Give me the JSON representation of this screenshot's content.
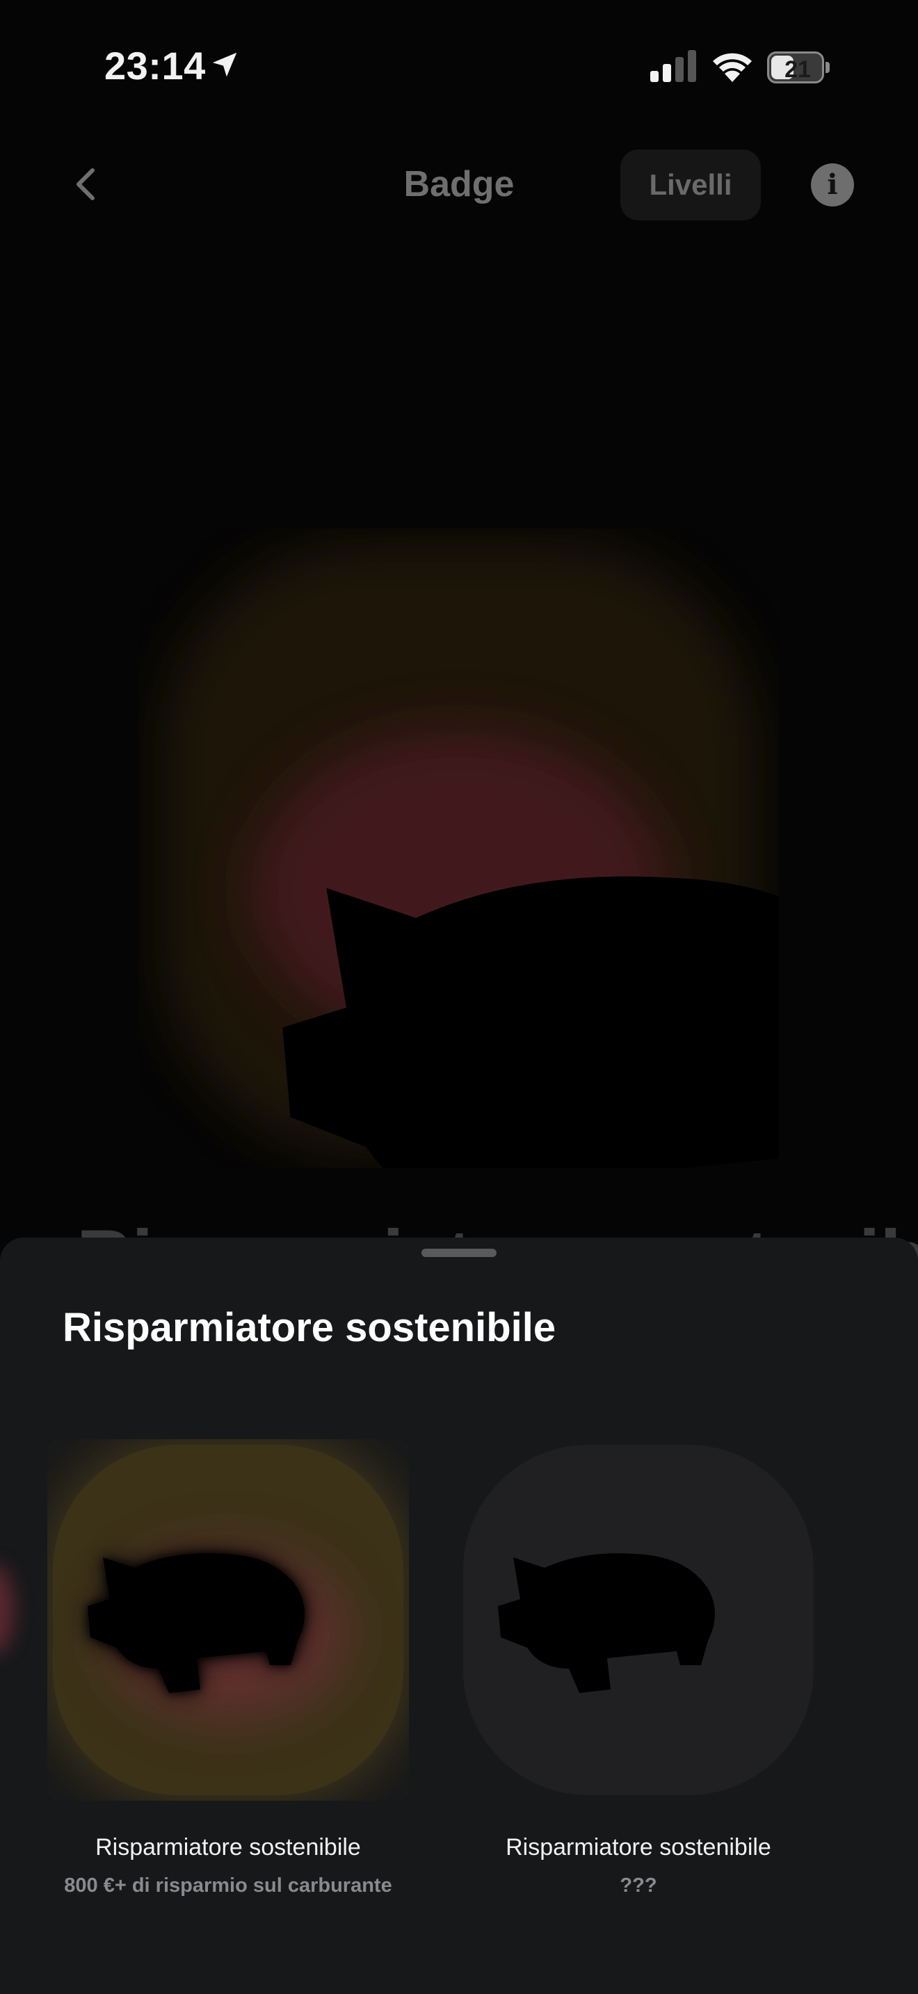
{
  "status_bar": {
    "time": "23:14",
    "battery_level": "21",
    "battery_fraction": 0.21,
    "icons": [
      "location-arrow-icon",
      "cellular-signal-icon",
      "wifi-icon",
      "battery-icon"
    ]
  },
  "nav": {
    "title": "Badge",
    "levels_label": "Livelli",
    "info_label": "i",
    "back_icon": "chevron-left-icon"
  },
  "hero": {
    "badge_icon": "piggy-bank-icon",
    "title_peek": "Risparmiatore sostenibile"
  },
  "sheet": {
    "title": "Risparmiatore sostenibile",
    "badges": [
      {
        "name": "Risparmiatore sostenibile",
        "description": "800 €+ di risparmio sul carburante",
        "state": "unlocked",
        "icon": "piggy-bank-icon"
      },
      {
        "name": "Risparmiatore sostenibile",
        "description": "???",
        "state": "locked",
        "icon": "piggy-bank-icon"
      }
    ]
  },
  "colors": {
    "background": "#050505",
    "sheet": "#17181a",
    "neon_gold": "#f5c53a",
    "neon_pink": "#ee6f86",
    "locked_outline": "#3b3b3d",
    "muted_text": "#8a8a8e"
  }
}
